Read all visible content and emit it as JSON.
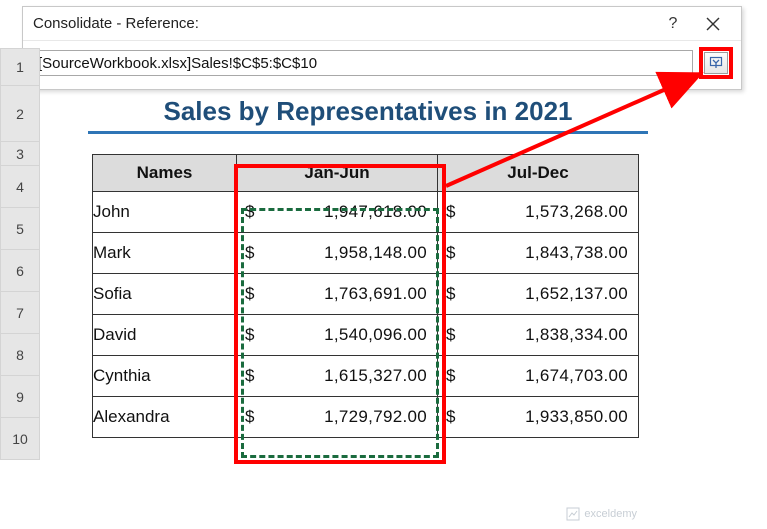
{
  "dialog": {
    "title": "Consolidate - Reference:",
    "help": "?",
    "reference_value": "[SourceWorkbook.xlsx]Sales!$C$5:$C$10"
  },
  "rowNumbers": [
    "1",
    "2",
    "3",
    "4",
    "5",
    "6",
    "7",
    "8",
    "9",
    "10"
  ],
  "sheet": {
    "title": "Sales by Representatives in 2021",
    "headers": {
      "names": "Names",
      "h1": "Jan-Jun",
      "h2": "Jul-Dec"
    },
    "currency": "$",
    "rows": [
      {
        "name": "John",
        "h1": "1,947,618.00",
        "h2": "1,573,268.00"
      },
      {
        "name": "Mark",
        "h1": "1,958,148.00",
        "h2": "1,843,738.00"
      },
      {
        "name": "Sofia",
        "h1": "1,763,691.00",
        "h2": "1,652,137.00"
      },
      {
        "name": "David",
        "h1": "1,540,096.00",
        "h2": "1,838,334.00"
      },
      {
        "name": "Cynthia",
        "h1": "1,615,327.00",
        "h2": "1,674,703.00"
      },
      {
        "name": "Alexandra",
        "h1": "1,729,792.00",
        "h2": "1,933,850.00"
      }
    ]
  },
  "watermark": "exceldemy"
}
